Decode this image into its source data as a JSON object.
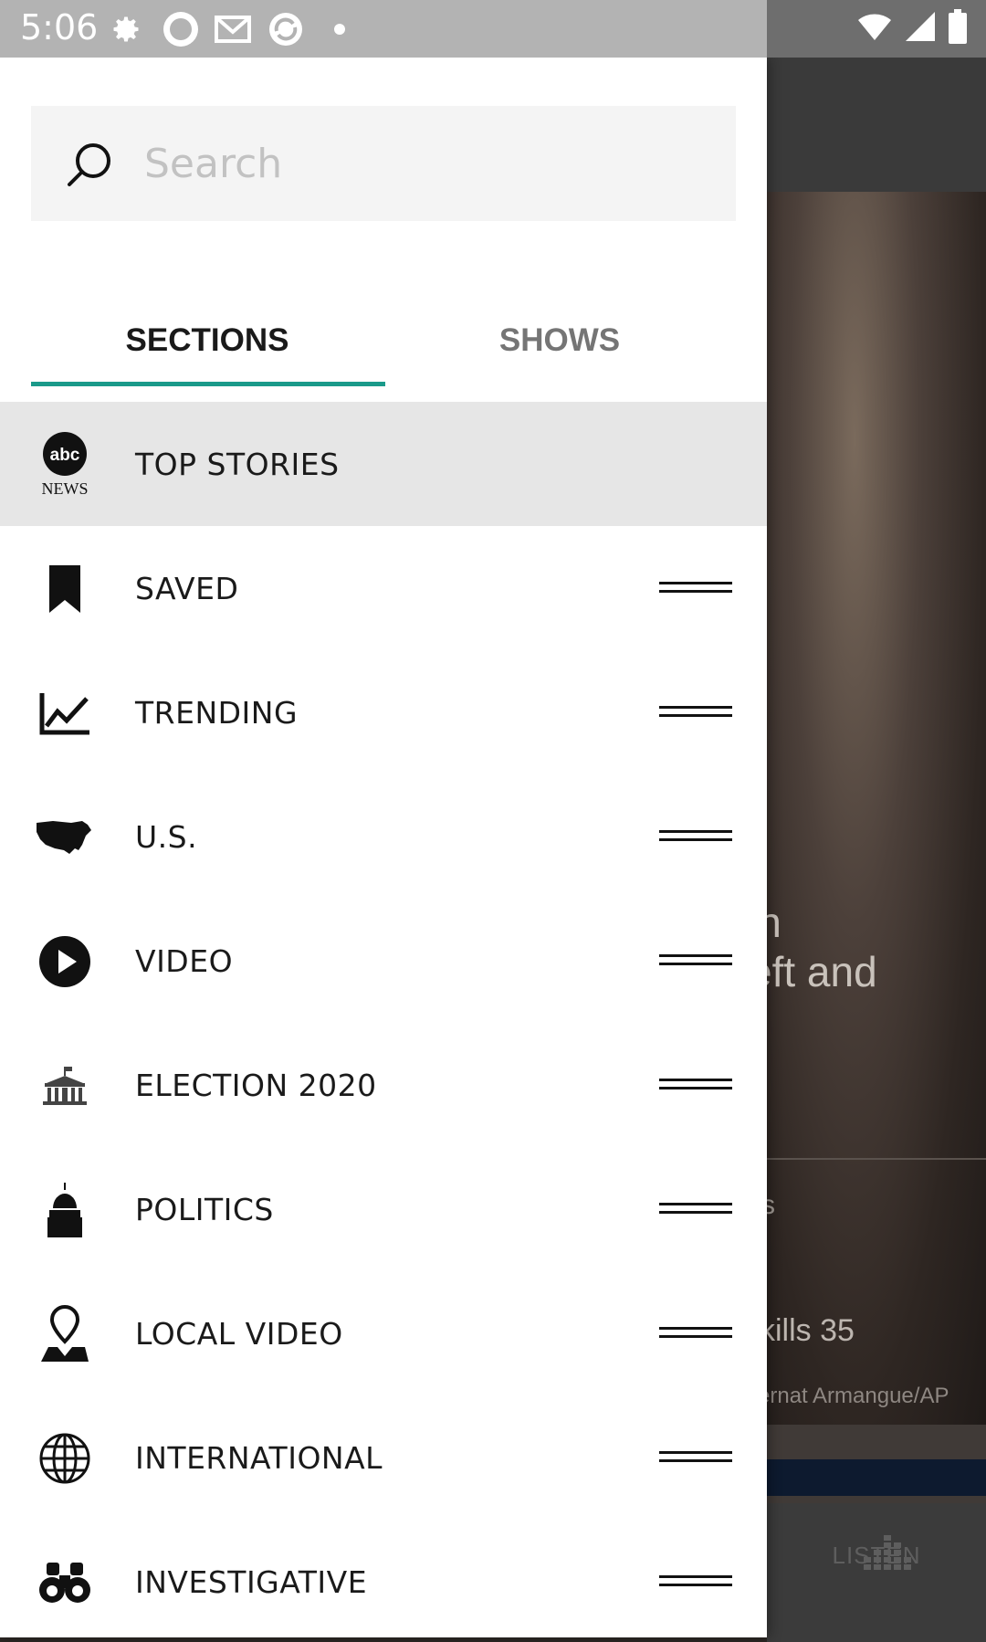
{
  "status_bar": {
    "time": "5:06",
    "notification_icons": [
      "settings-icon",
      "usa-today-icon",
      "gmail-icon",
      "sync-icon",
      "dot-icon"
    ],
    "system_icons": [
      "wifi-icon",
      "signal-icon",
      "battery-icon"
    ]
  },
  "search": {
    "placeholder": "Search"
  },
  "tabs": [
    {
      "label": "SECTIONS",
      "active": true
    },
    {
      "label": "SHOWS",
      "active": false
    }
  ],
  "menu": [
    {
      "label": "TOP STORIES",
      "icon": "abc-news-logo",
      "active": true
    },
    {
      "label": "SAVED",
      "icon": "bookmark-icon"
    },
    {
      "label": "TRENDING",
      "icon": "trending-chart-icon"
    },
    {
      "label": "U.S.",
      "icon": "us-map-icon"
    },
    {
      "label": "VIDEO",
      "icon": "play-icon"
    },
    {
      "label": "ELECTION 2020",
      "icon": "white-house-icon"
    },
    {
      "label": "POLITICS",
      "icon": "capitol-icon"
    },
    {
      "label": "LOCAL VIDEO",
      "icon": "map-pin-icon"
    },
    {
      "label": "INTERNATIONAL",
      "icon": "globe-icon"
    },
    {
      "label": "INVESTIGATIVE",
      "icon": "binoculars-icon"
    }
  ],
  "logo_text": {
    "abc": "abc",
    "news": "NEWS"
  },
  "background": {
    "headline_line1": "in",
    "headline_line2": "eft and",
    "tag": "s",
    "subhead": "kills 35",
    "credit": "ernat Armangue/AP",
    "listen_label": "LISTEN"
  },
  "colors": {
    "accent": "#1a9a8a",
    "active_row": "#e6e6e6"
  }
}
